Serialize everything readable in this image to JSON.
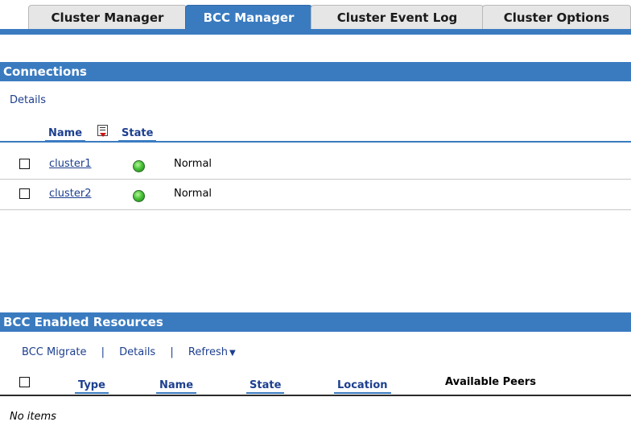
{
  "tabs": [
    {
      "label": "Cluster Manager",
      "active": false
    },
    {
      "label": "BCC Manager",
      "active": true
    },
    {
      "label": "Cluster Event Log",
      "active": false
    },
    {
      "label": "Cluster Options",
      "active": false
    }
  ],
  "connections": {
    "title": "Connections",
    "details_link": "Details",
    "columns": {
      "name": "Name",
      "state": "State"
    },
    "rows": [
      {
        "name": "cluster1",
        "state": "Normal"
      },
      {
        "name": "cluster2",
        "state": "Normal"
      }
    ]
  },
  "resources": {
    "title": "BCC Enabled Resources",
    "actions": {
      "migrate": "BCC Migrate",
      "sep": "|",
      "details": "Details",
      "refresh": "Refresh"
    },
    "columns": {
      "type": "Type",
      "name": "Name",
      "state": "State",
      "location": "Location",
      "peers": "Available Peers"
    },
    "empty_text": "No items"
  },
  "colors": {
    "accent": "#3a7bc0",
    "link": "#1d3f8f",
    "status_ok": "#49c43a"
  }
}
